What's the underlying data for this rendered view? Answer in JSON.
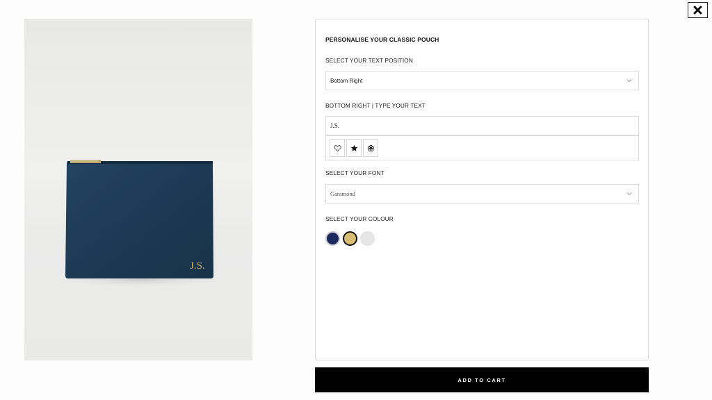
{
  "close": {
    "icon": "close-icon"
  },
  "product": {
    "monogram": "J.S.",
    "colors": {
      "pouch": "#1c3a55",
      "monogram": "#c9ad6a"
    }
  },
  "form": {
    "title": "PERSONALISE YOUR CLASSIC POUCH",
    "position_label": "SELECT YOUR TEXT POSITION",
    "position_value": "Bottom Right",
    "text_label": "BOTTOM RIGHT | TYPE YOUR TEXT",
    "text_value": "J.S.",
    "symbols": [
      "heart-icon",
      "star-icon",
      "flower-icon"
    ],
    "font_label": "SELECT YOUR FONT",
    "font_value": "Garamond",
    "colour_label": "SELECT YOUR COLOUR",
    "colours": [
      {
        "name": "navy",
        "hex": "#1b2a5e",
        "selected": false
      },
      {
        "name": "gold",
        "hex": "#d6bd72",
        "selected": true
      },
      {
        "name": "silver",
        "hex": "#e6e6e6",
        "selected": false
      }
    ]
  },
  "add_to_cart": "ADD TO CART"
}
